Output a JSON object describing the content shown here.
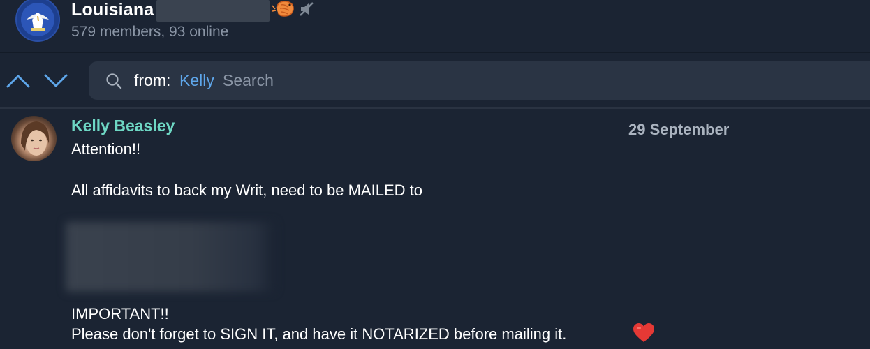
{
  "header": {
    "group_name": "Louisiana",
    "subtitle": "579 members, 93 online"
  },
  "search": {
    "prefix": "from:",
    "chip": "Kelly",
    "placeholder": "Search"
  },
  "message": {
    "sender": "Kelly Beasley",
    "date": "29 September",
    "lines": [
      "Attention!!",
      "All affidavits to back my Writ, need to be MAILED to",
      "IMPORTANT!!",
      "Please don't forget to SIGN IT, and have it NOTARIZED before mailing it."
    ]
  },
  "colors": {
    "background": "#1b2433",
    "sender": "#6ed7c4",
    "accent": "#5ea6ea",
    "heart": "#e53935"
  },
  "icons": {
    "group_avatar": "louisiana-pelican-seal-icon",
    "shrimp": "shrimp-icon",
    "muted": "mute-icon",
    "nav_up": "chevron-up-icon",
    "nav_down": "chevron-down-icon",
    "search": "search-icon",
    "heart": "red-heart-icon"
  }
}
